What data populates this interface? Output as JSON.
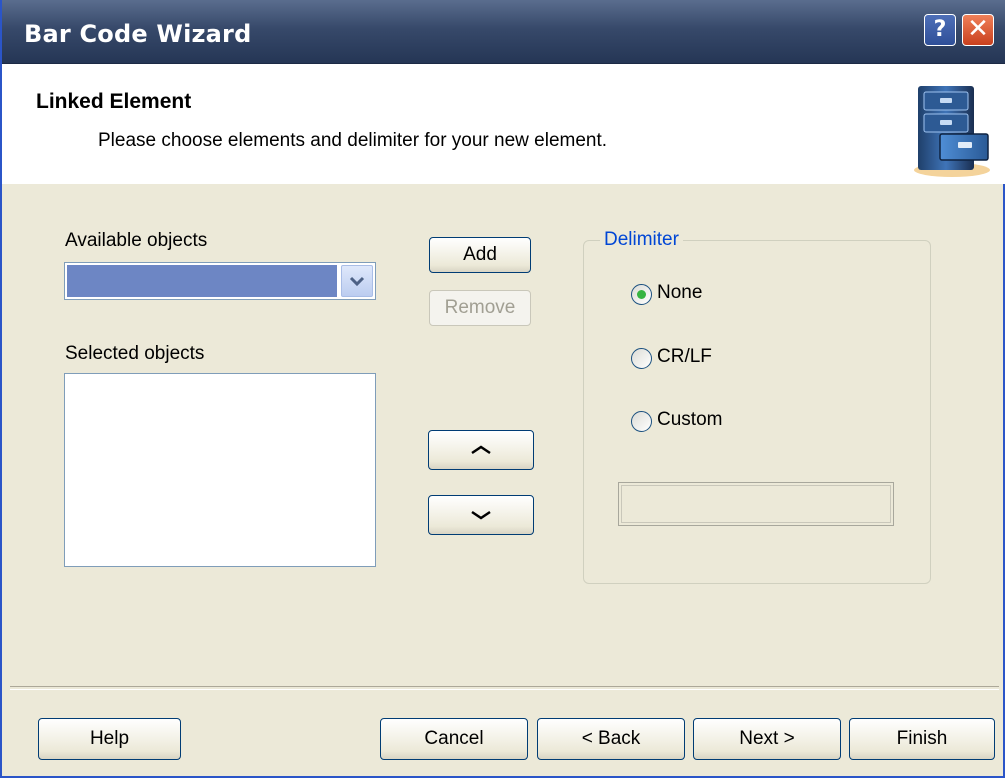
{
  "window": {
    "title": "Bar Code Wizard",
    "help_button": "?",
    "close_button": "✕"
  },
  "header": {
    "title": "Linked Element",
    "subtitle": "Please choose elements and delimiter for your new element.",
    "icon": "file-cabinet-icon"
  },
  "available_objects": {
    "label": "Available objects",
    "value": ""
  },
  "selected_objects": {
    "label": "Selected objects",
    "items": []
  },
  "buttons": {
    "add": "Add",
    "remove": "Remove",
    "move_up_icon": "chevron-up-icon",
    "move_down_icon": "chevron-down-icon"
  },
  "delimiter": {
    "title": "Delimiter",
    "options": [
      {
        "label": "None",
        "selected": true
      },
      {
        "label": "CR/LF",
        "selected": false
      },
      {
        "label": "Custom",
        "selected": false
      }
    ],
    "custom_value": ""
  },
  "footer": {
    "help": "Help",
    "cancel": "Cancel",
    "back": "< Back",
    "next": "Next >",
    "finish": "Finish"
  },
  "colors": {
    "title_bar": "#37496a",
    "face": "#ece9d8",
    "selection": "#6d86c4",
    "group_title": "#0046d5",
    "radio_dot": "#37b442"
  }
}
